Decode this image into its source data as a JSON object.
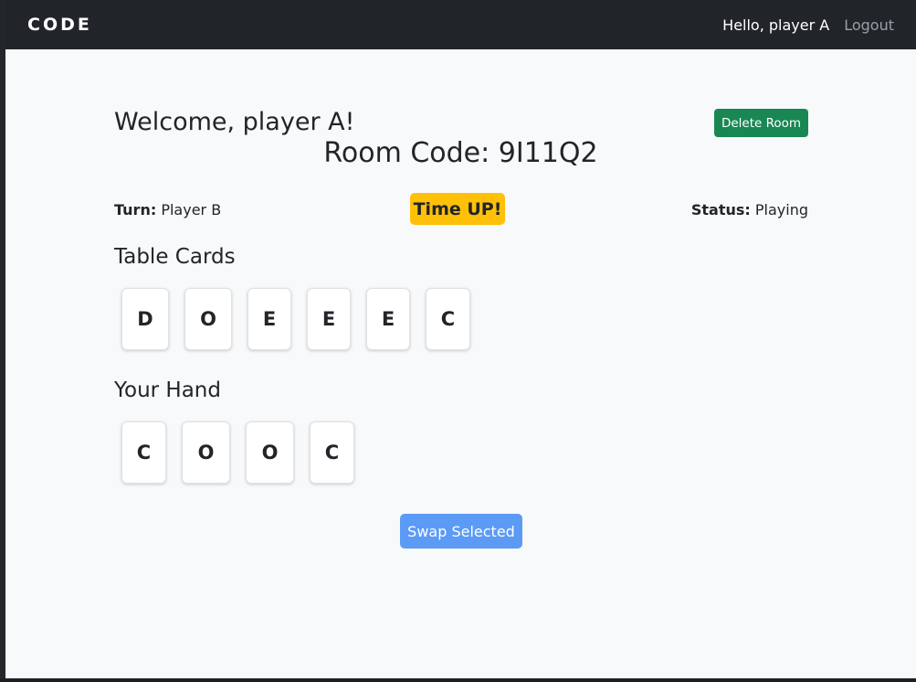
{
  "navbar": {
    "brand": "CODE",
    "greeting": "Hello, player A",
    "logout_label": "Logout"
  },
  "header": {
    "welcome": "Welcome, player A!",
    "room_code": "Room Code: 9I11Q2",
    "delete_room_label": "Delete Room"
  },
  "game_info": {
    "turn_label": "Turn:",
    "turn_value": "Player B",
    "timer_badge": "Time UP!",
    "status_label": "Status:",
    "status_value": "Playing"
  },
  "table": {
    "title": "Table Cards",
    "cards": [
      "D",
      "O",
      "E",
      "E",
      "E",
      "C"
    ]
  },
  "hand": {
    "title": "Your Hand",
    "cards": [
      "C",
      "O",
      "O",
      "C"
    ]
  },
  "actions": {
    "swap_label": "Swap Selected"
  },
  "colors": {
    "navbar": "#212529",
    "delete_button": "#198754",
    "timer_badge": "#ffc107",
    "swap_button": "#5b9bf6"
  }
}
